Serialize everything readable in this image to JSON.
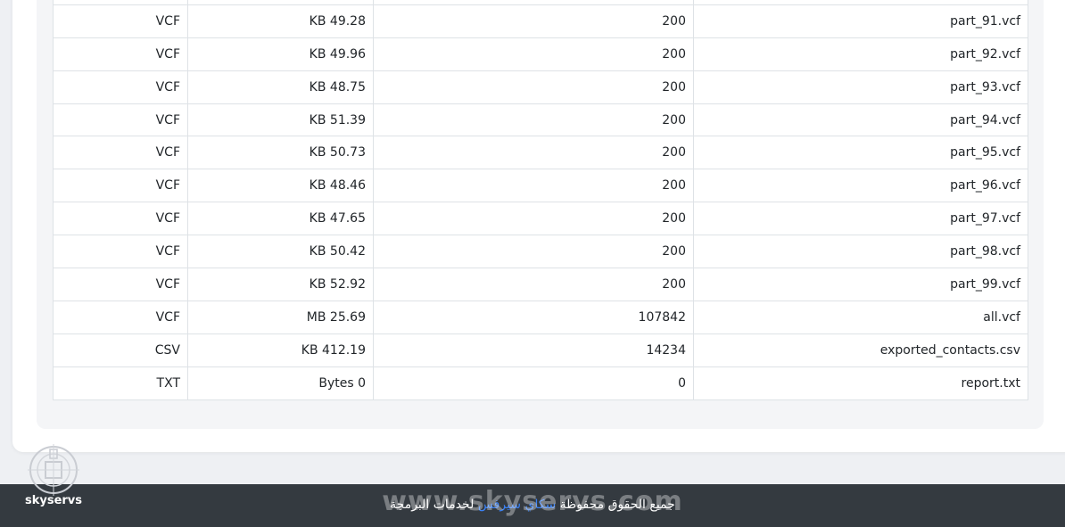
{
  "files_table": {
    "rows": [
      {
        "name": "",
        "count": "",
        "size": "",
        "type": ""
      },
      {
        "name": "part_91.vcf",
        "count": "200",
        "size": "KB 49.28",
        "type": "VCF"
      },
      {
        "name": "part_92.vcf",
        "count": "200",
        "size": "KB 49.96",
        "type": "VCF"
      },
      {
        "name": "part_93.vcf",
        "count": "200",
        "size": "KB 48.75",
        "type": "VCF"
      },
      {
        "name": "part_94.vcf",
        "count": "200",
        "size": "KB 51.39",
        "type": "VCF"
      },
      {
        "name": "part_95.vcf",
        "count": "200",
        "size": "KB 50.73",
        "type": "VCF"
      },
      {
        "name": "part_96.vcf",
        "count": "200",
        "size": "KB 48.46",
        "type": "VCF"
      },
      {
        "name": "part_97.vcf",
        "count": "200",
        "size": "KB 47.65",
        "type": "VCF"
      },
      {
        "name": "part_98.vcf",
        "count": "200",
        "size": "KB 50.42",
        "type": "VCF"
      },
      {
        "name": "part_99.vcf",
        "count": "200",
        "size": "KB 52.92",
        "type": "VCF"
      },
      {
        "name": "all.vcf",
        "count": "107842",
        "size": "MB 25.69",
        "type": "VCF"
      },
      {
        "name": "exported_contacts.csv",
        "count": "14234",
        "size": "KB 412.19",
        "type": "CSV"
      },
      {
        "name": "report.txt",
        "count": "0",
        "size": "Bytes 0",
        "type": "TXT"
      }
    ]
  },
  "footer": {
    "rights_text": "جميع الحقوق محفوظة",
    "brand_link": "سكاي سيرفس",
    "tail_text": "لخدمات البرمجة",
    "watermark": "www.skyservs.com"
  },
  "logo": {
    "text": "skyservs"
  },
  "colors": {
    "footer_bg": "#343a40",
    "page_bg": "#eef0f3",
    "border": "#dee2e6",
    "link": "#3b82f6"
  }
}
